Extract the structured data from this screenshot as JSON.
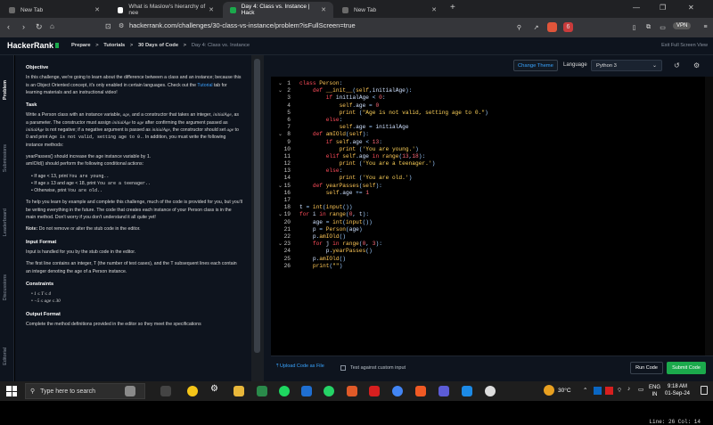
{
  "tabs": [
    {
      "label": "New Tab"
    },
    {
      "label": "What is Maslow's hierarchy of nee"
    },
    {
      "label": "Day 4: Class vs. Instance | Hack"
    },
    {
      "label": "New Tab"
    }
  ],
  "window_controls": {
    "minimize": "—",
    "maximize": "❐",
    "close": "✕"
  },
  "address_bar": {
    "url": "hackerrank.com/challenges/30-class-vs-instance/problem?isFullScreen=true",
    "vpn_label": "VPN",
    "badge_count": "6"
  },
  "header": {
    "logo": "HackerRank",
    "breadcrumbs": [
      "Prepare",
      ">",
      "Tutorials",
      ">",
      "30 Days of Code",
      ">",
      "Day 4: Class vs. Instance"
    ],
    "exit_full_screen": "Exit Full Screen View"
  },
  "side_tabs": [
    "Problem",
    "Submissions",
    "Leaderboard",
    "Discussions",
    "Editorial"
  ],
  "problem": {
    "objective_title": "Objective",
    "objective_p1": "In this challenge, we're going to learn about the difference between a class and an instance; because this is an Object Oriented concept, it's only enabled in certain languages. Check out the",
    "tutorial_link": "Tutorial",
    "objective_p1_end": "tab for learning materials and an instructional video!",
    "task_title": "Task",
    "task_p1a": "Write a Person class with an instance variable,",
    "age_var": "age",
    "task_p1b": ", and a constructor that takes an integer,",
    "initial_age": "initialAge",
    "task_p1c": ", as a parameter. The constructor must assign",
    "task_p1d": "to",
    "task_p1e": "after confirming the argument passed as",
    "task_p1f": "is not negative; if a negative argument is passed as",
    "task_p1g": ", the constructor should set",
    "task_p1h": "to 0 and print",
    "invalid_msg": "Age is not valid, setting age to 0.",
    "task_p1i": ". In addition, you must write the following instance methods:",
    "methods": [
      "yearPasses() should increase the age instance variable by 1.",
      "amIOld() should perform the following conditional actions:"
    ],
    "conditions": [
      {
        "cond": "If age < 13, print",
        "out": "You are young.."
      },
      {
        "cond": "If age ≥ 13 and age < 18, print",
        "out": "You are a teenager.."
      },
      {
        "cond": "Otherwise, print",
        "out": "You are old.."
      }
    ],
    "help_text": "To help you learn by example and complete this challenge, much of the code is provided for you, but you'll be writing everything in the future. The code that creates each instance of your Person class is in the main method. Don't worry if you don't understand it all quite yet!",
    "note_label": "Note:",
    "note_text": "Do not remove or alter the stub code in the editor.",
    "input_title": "Input Format",
    "input_p1": "Input is handled for you by the stub code in the editor.",
    "input_p2": "The first line contains an integer, T (the number of test cases), and the T subsequent lines each contain an integer denoting the age of a Person instance.",
    "constraints_title": "Constraints",
    "constraints": [
      "1 ≤ T ≤ 4",
      "−5 ≤ age ≤ 30"
    ],
    "output_title": "Output Format",
    "output_p1": "Complete the method definitions provided in the editor so they meet the specifications"
  },
  "editor": {
    "change_theme": "Change Theme",
    "language_label": "Language",
    "language": "Python 3",
    "status": "Line: 26 Col: 14",
    "upload": "Upload Code as File",
    "custom_input": "Test against custom input",
    "run": "Run Code",
    "submit": "Submit Code",
    "lines": [
      {
        "n": "1",
        "code": "class Person:"
      },
      {
        "n": "2",
        "code": "    def __init__(self,initialAge):"
      },
      {
        "n": "3",
        "code": "        if initialAge < 0:"
      },
      {
        "n": "4",
        "code": "            self.age = 0"
      },
      {
        "n": "5",
        "code": "            print (\"Age is not valid, setting age to 0.\")"
      },
      {
        "n": "6",
        "code": "        else:"
      },
      {
        "n": "7",
        "code": "            self.age = initialAge"
      },
      {
        "n": "8",
        "code": "    def amIOld(self):"
      },
      {
        "n": "9",
        "code": "        if self.age < 13:"
      },
      {
        "n": "10",
        "code": "            print ('You are young.')"
      },
      {
        "n": "11",
        "code": "        elif self.age in range(13,18):"
      },
      {
        "n": "12",
        "code": "            print ('You are a teenager.')"
      },
      {
        "n": "13",
        "code": "        else:"
      },
      {
        "n": "14",
        "code": "            print ('You are old.')"
      },
      {
        "n": "15",
        "code": "    def yearPasses(self):"
      },
      {
        "n": "16",
        "code": "        self.age += 1"
      },
      {
        "n": "17",
        "code": ""
      },
      {
        "n": "18",
        "code": "t = int(input())"
      },
      {
        "n": "19",
        "code": "for i in range(0, t):"
      },
      {
        "n": "20",
        "code": "    age = int(input())"
      },
      {
        "n": "21",
        "code": "    p = Person(age)"
      },
      {
        "n": "22",
        "code": "    p.amIOld()"
      },
      {
        "n": "23",
        "code": "    for j in range(0, 3):"
      },
      {
        "n": "24",
        "code": "        p.yearPasses()"
      },
      {
        "n": "25",
        "code": "    p.amIOld()"
      },
      {
        "n": "26",
        "code": "    print(\"\")"
      }
    ]
  },
  "taskbar": {
    "search_placeholder": "Type here to search",
    "temperature": "30°C",
    "lang": "ENG",
    "region": "IN",
    "time": "9:18 AM",
    "date": "01-Sep-24"
  }
}
